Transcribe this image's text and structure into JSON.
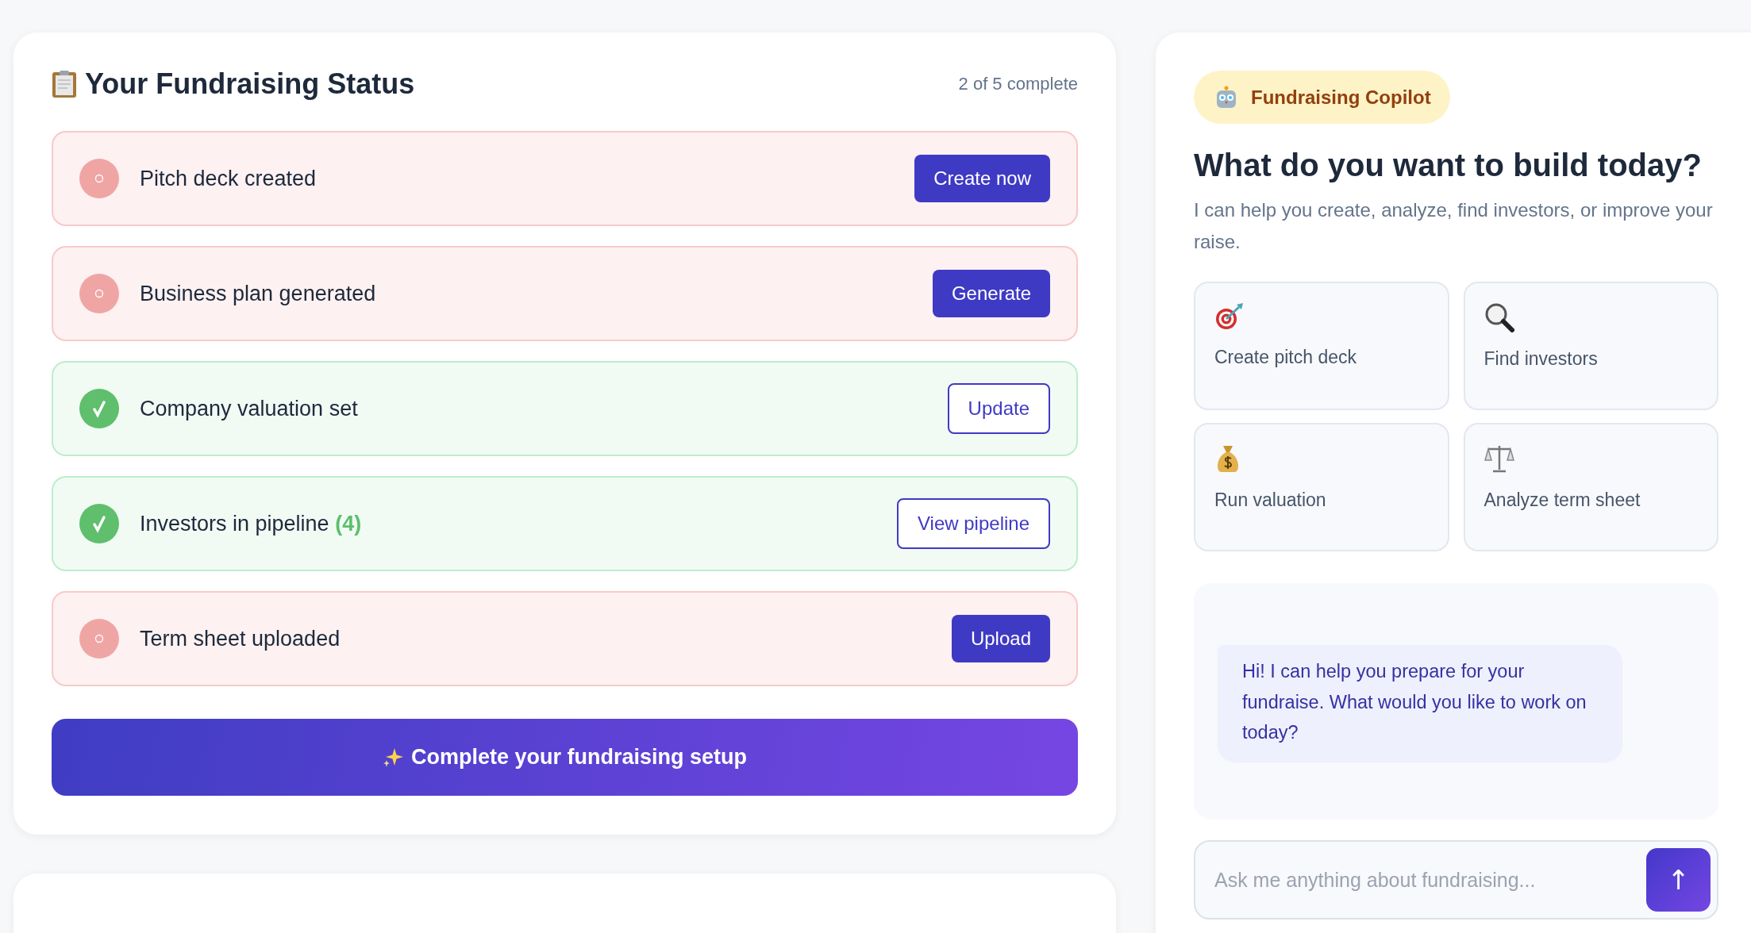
{
  "status_card": {
    "title": "Your Fundraising Status",
    "progress": "2 of 5 complete",
    "items": [
      {
        "label": "Pitch deck created",
        "done": false,
        "action": {
          "label": "Create now",
          "kind": "filled"
        }
      },
      {
        "label": "Business plan generated",
        "done": false,
        "action": {
          "label": "Generate",
          "kind": "filled"
        }
      },
      {
        "label": "Company valuation set",
        "done": true,
        "action": {
          "label": "Update",
          "kind": "outline"
        }
      },
      {
        "label": "Investors in pipeline",
        "count": "(4)",
        "done": true,
        "action": {
          "label": "View pipeline",
          "kind": "outline"
        }
      },
      {
        "label": "Term sheet uploaded",
        "done": false,
        "action": {
          "label": "Upload",
          "kind": "filled"
        }
      }
    ],
    "cta": "Complete your fundraising setup"
  },
  "copilot": {
    "badge": "Fundraising Copilot",
    "heading": "What do you want to build today?",
    "subtitle": "I can help you create, analyze, find investors, or improve your raise.",
    "actions": [
      {
        "label": "Create pitch deck",
        "kind": "target"
      },
      {
        "label": "Find investors",
        "kind": "search"
      },
      {
        "label": "Run valuation",
        "kind": "money"
      },
      {
        "label": "Analyze term sheet",
        "kind": "scales"
      }
    ],
    "messages": [
      {
        "text": "Hi! I can help you prepare for your fundraise. What would you like to work on today?"
      }
    ],
    "input": {
      "placeholder": "Ask me anything about fundraising..."
    },
    "send": "↑"
  }
}
